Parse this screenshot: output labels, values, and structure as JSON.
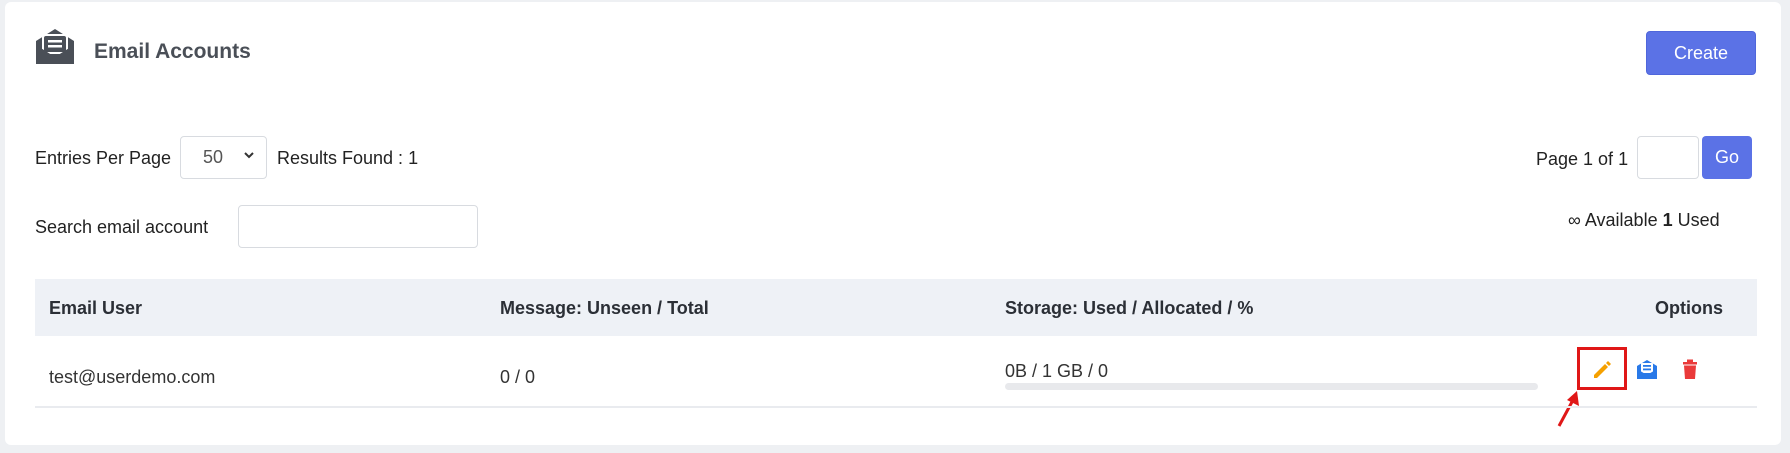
{
  "header": {
    "title": "Email Accounts",
    "create_label": "Create"
  },
  "controls": {
    "entries_label": "Entries Per Page",
    "entries_value": "50",
    "results_label": "Results Found : 1",
    "page_label": "Page 1 of 1",
    "go_label": "Go",
    "search_label": "Search email account",
    "search_value": "",
    "available_symbol": "∞",
    "available_text": "Available",
    "used_count": "1",
    "used_text": "Used"
  },
  "table": {
    "columns": [
      "Email User",
      "Message: Unseen / Total",
      "Storage: Used / Allocated / %",
      "Options"
    ],
    "rows": [
      {
        "email": "test@userdemo.com",
        "messages": "0 / 0",
        "storage": "0B / 1 GB / 0",
        "storage_percent": 0,
        "options": [
          "edit-icon",
          "mail-settings-icon",
          "trash-icon"
        ]
      }
    ]
  },
  "colors": {
    "accent": "#5b72e6",
    "edit": "#f5a000",
    "mail": "#2979e8",
    "delete": "#ea3a3a",
    "highlight": "#e01717"
  }
}
